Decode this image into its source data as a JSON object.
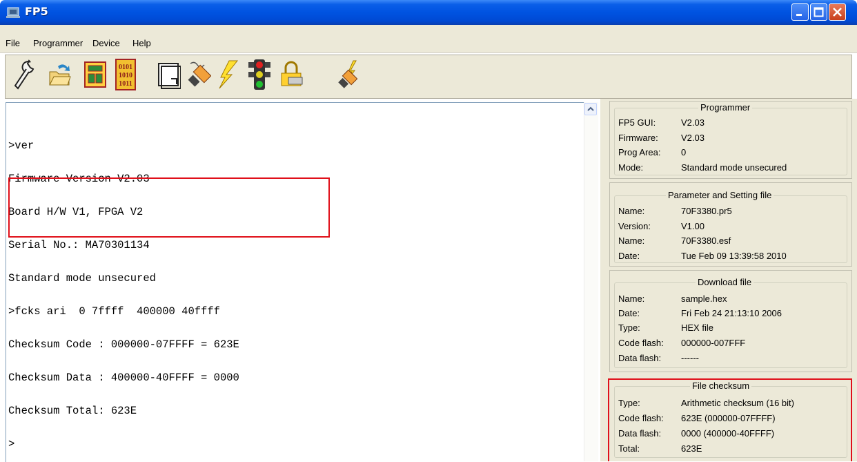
{
  "window": {
    "title": "FP5"
  },
  "menu": [
    "File",
    "Programmer",
    "Device",
    "Help"
  ],
  "toolbar": [
    "settings-wrench-icon",
    "open-folder-icon",
    "memory-map-icon",
    "binary-data-icon",
    "blank-document-icon",
    "connect-cable-icon",
    "lightning-program-icon",
    "traffic-light-icon",
    "lock-security-icon",
    "disconnect-cable-icon"
  ],
  "console": {
    "lines": [
      ">ver",
      "Firmware Version V2.03",
      "Board H/W V1, FPGA V2",
      "Serial No.: MA70301134",
      "Standard mode unsecured",
      ">fcks ari  0 7ffff  400000 40ffff",
      "Checksum Code : 000000-07FFFF = 623E",
      "Checksum Data : 400000-40FFFF = 0000",
      "Checksum Total: 623E",
      ">"
    ]
  },
  "panel": {
    "programmer": {
      "title": "Programmer",
      "rows": [
        {
          "label": "FP5 GUI:",
          "value": "V2.03"
        },
        {
          "label": "Firmware:",
          "value": "V2.03"
        },
        {
          "label": "Prog Area:",
          "value": "0"
        },
        {
          "label": "Mode:",
          "value": "Standard mode unsecured"
        }
      ]
    },
    "parameter": {
      "title": "Parameter and Setting file",
      "rows": [
        {
          "label": "Name:",
          "value": "70F3380.pr5"
        },
        {
          "label": "Version:",
          "value": "V1.00"
        },
        {
          "label": "Name:",
          "value": "70F3380.esf"
        },
        {
          "label": "Date:",
          "value": "Tue Feb 09 13:39:58 2010"
        }
      ]
    },
    "download": {
      "title": "Download file",
      "rows": [
        {
          "label": "Name:",
          "value": "sample.hex"
        },
        {
          "label": "Date:",
          "value": "Fri Feb 24 21:13:10 2006"
        },
        {
          "label": "Type:",
          "value": "HEX file"
        },
        {
          "label": "Code flash:",
          "value": "000000-007FFF"
        },
        {
          "label": "Data flash:",
          "value": "------"
        }
      ]
    },
    "checksum": {
      "title": "File checksum",
      "rows": [
        {
          "label": "Type:",
          "value": "Arithmetic checksum (16 bit)"
        },
        {
          "label": "Code flash:",
          "value": "623E (000000-07FFFF)"
        },
        {
          "label": "Data flash:",
          "value": "0000 (400000-40FFFF)"
        },
        {
          "label": "Total:",
          "value": "623E"
        }
      ]
    }
  },
  "colors": {
    "highlight": "#e0101a",
    "titlebar": "#0053e1",
    "face": "#ece9d8"
  }
}
